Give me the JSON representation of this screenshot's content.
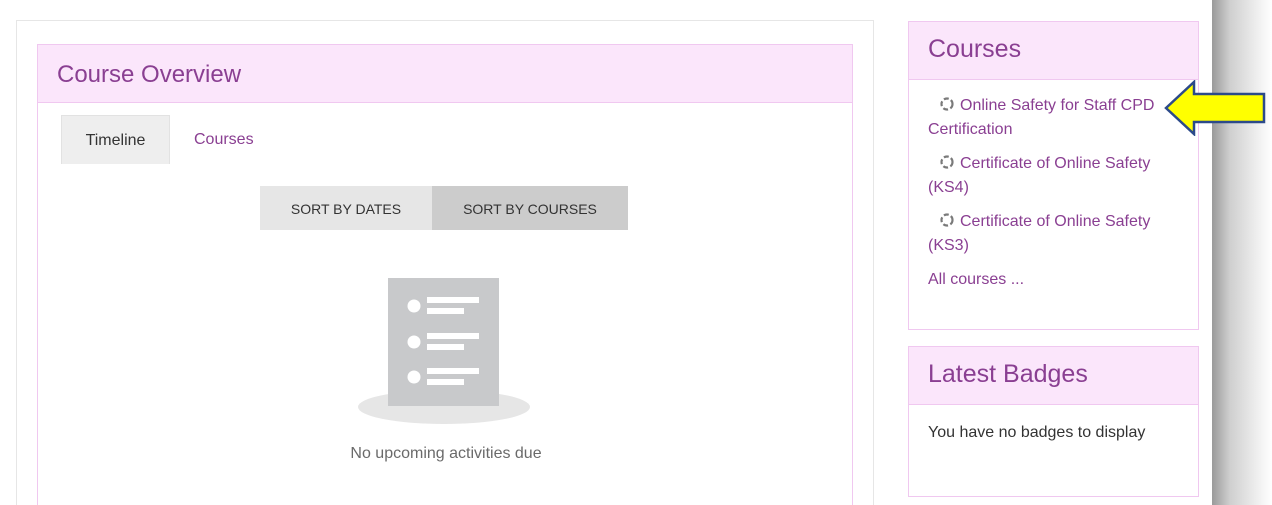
{
  "course_overview": {
    "title": "Course Overview",
    "tabs": [
      {
        "label": "Timeline",
        "active": true
      },
      {
        "label": "Courses",
        "active": false
      }
    ],
    "sort_buttons": [
      {
        "label": "SORT BY DATES"
      },
      {
        "label": "SORT BY COURSES",
        "selected": true
      }
    ],
    "empty_message": "No upcoming activities due"
  },
  "courses_block": {
    "title": "Courses",
    "items": [
      {
        "label": "Online Safety for Staff CPD Certification",
        "icon": "course-icon"
      },
      {
        "label": "Certificate of Online Safety (KS4)",
        "icon": "course-icon"
      },
      {
        "label": "Certificate of Online Safety (KS3)",
        "icon": "course-icon"
      }
    ],
    "all_courses_label": "All courses ..."
  },
  "badges_block": {
    "title": "Latest Badges",
    "message": "You have no badges to display"
  },
  "colors": {
    "accent": "#8a3f92",
    "header_bg": "#fbe6fb",
    "border": "#f0c8f0",
    "arrow_fill": "#ffff00",
    "arrow_stroke": "#2c4a8a"
  }
}
